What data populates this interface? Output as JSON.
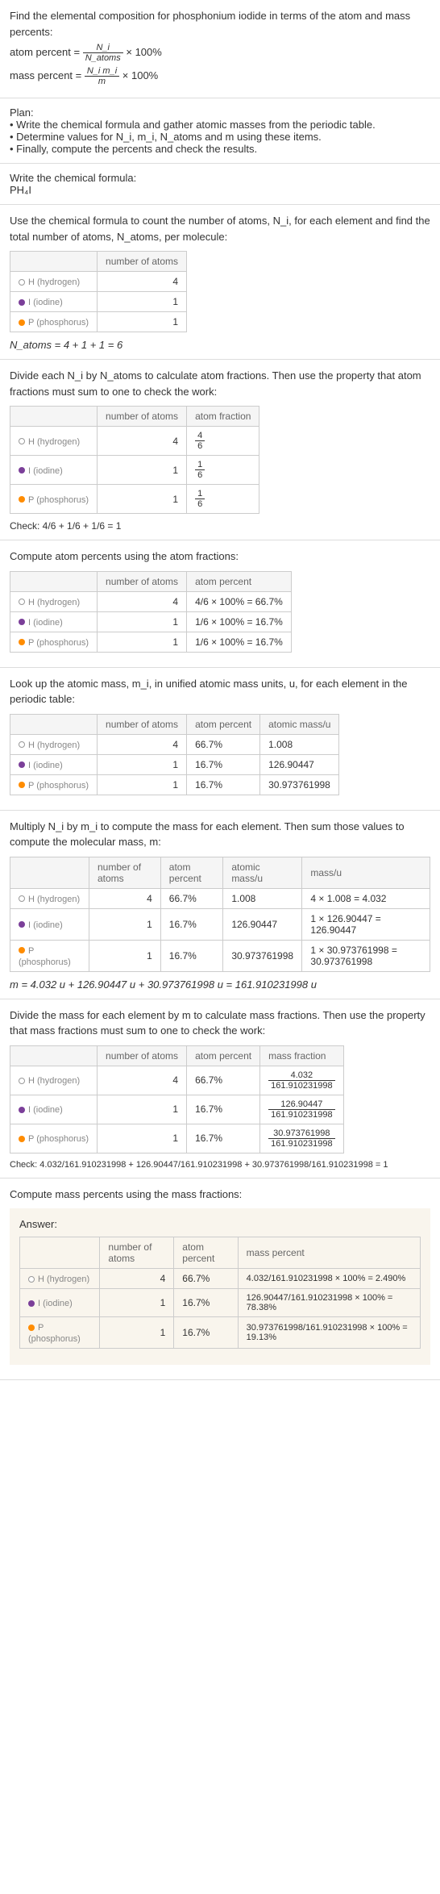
{
  "intro": {
    "title": "Find the elemental composition for phosphonium iodide in terms of the atom and mass percents:",
    "atom_percent_label": "atom percent = ",
    "atom_percent_frac_num": "N_i",
    "atom_percent_frac_den": "N_atoms",
    "times_100": " × 100%",
    "mass_percent_label": "mass percent = ",
    "mass_percent_frac_num": "N_i m_i",
    "mass_percent_frac_den": "m"
  },
  "plan": {
    "heading": "Plan:",
    "step1": "• Write the chemical formula and gather atomic masses from the periodic table.",
    "step2": "• Determine values for N_i, m_i, N_atoms and m using these items.",
    "step3": "• Finally, compute the percents and check the results."
  },
  "formula_section": {
    "heading": "Write the chemical formula:",
    "formula": "PH₄I"
  },
  "count_section": {
    "text": "Use the chemical formula to count the number of atoms, N_i, for each element and find the total number of atoms, N_atoms, per molecule:",
    "header_atoms": "number of atoms",
    "h_label": "H (hydrogen)",
    "i_label": "I (iodine)",
    "p_label": "P (phosphorus)",
    "h_atoms": "4",
    "i_atoms": "1",
    "p_atoms": "1",
    "total": "N_atoms = 4 + 1 + 1 = 6"
  },
  "atom_frac_section": {
    "text": "Divide each N_i by N_atoms to calculate atom fractions. Then use the property that atom fractions must sum to one to check the work:",
    "header_frac": "atom fraction",
    "h_frac_num": "4",
    "h_frac_den": "6",
    "i_frac_num": "1",
    "i_frac_den": "6",
    "p_frac_num": "1",
    "p_frac_den": "6",
    "check": "Check: 4/6 + 1/6 + 1/6 = 1"
  },
  "atom_pct_section": {
    "text": "Compute atom percents using the atom fractions:",
    "header_pct": "atom percent",
    "h_pct": "4/6 × 100% = 66.7%",
    "i_pct": "1/6 × 100% = 16.7%",
    "p_pct": "1/6 × 100% = 16.7%"
  },
  "mass_lookup_section": {
    "text": "Look up the atomic mass, m_i, in unified atomic mass units, u, for each element in the periodic table:",
    "header_mass": "atomic mass/u",
    "h_pct": "66.7%",
    "i_pct": "16.7%",
    "p_pct": "16.7%",
    "h_mass": "1.008",
    "i_mass": "126.90447",
    "p_mass": "30.973761998"
  },
  "mol_mass_section": {
    "text": "Multiply N_i by m_i to compute the mass for each element. Then sum those values to compute the molecular mass, m:",
    "header_massu": "mass/u",
    "h_calc": "4 × 1.008 = 4.032",
    "i_calc": "1 × 126.90447 = 126.90447",
    "p_calc": "1 × 30.973761998 = 30.973761998",
    "total": "m = 4.032 u + 126.90447 u + 30.973761998 u = 161.910231998 u"
  },
  "mass_frac_section": {
    "text": "Divide the mass for each element by m to calculate mass fractions. Then use the property that mass fractions must sum to one to check the work:",
    "header_massfrac": "mass fraction",
    "h_num": "4.032",
    "h_den": "161.910231998",
    "i_num": "126.90447",
    "i_den": "161.910231998",
    "p_num": "30.973761998",
    "p_den": "161.910231998",
    "check": "Check: 4.032/161.910231998 + 126.90447/161.910231998 + 30.973761998/161.910231998 = 1"
  },
  "mass_pct_section": {
    "text": "Compute mass percents using the mass fractions:"
  },
  "answer": {
    "heading": "Answer:",
    "header_masspct": "mass percent",
    "h_pct": "66.7%",
    "i_pct": "16.7%",
    "p_pct": "16.7%",
    "h_calc": "4.032/161.910231998 × 100% = 2.490%",
    "i_calc": "126.90447/161.910231998 × 100% = 78.38%",
    "p_calc": "30.973761998/161.910231998 × 100% = 19.13%"
  },
  "chart_data": {
    "type": "table",
    "title": "Elemental composition of phosphonium iodide (PH4I)",
    "formula": "PH4I",
    "N_atoms": 6,
    "molecular_mass_u": 161.910231998,
    "elements": [
      {
        "symbol": "H",
        "name": "hydrogen",
        "number_of_atoms": 4,
        "atom_fraction": "4/6",
        "atom_percent": 66.7,
        "atomic_mass_u": 1.008,
        "mass_u": 4.032,
        "mass_fraction_num": 4.032,
        "mass_fraction_den": 161.910231998,
        "mass_percent": 2.49
      },
      {
        "symbol": "I",
        "name": "iodine",
        "number_of_atoms": 1,
        "atom_fraction": "1/6",
        "atom_percent": 16.7,
        "atomic_mass_u": 126.90447,
        "mass_u": 126.90447,
        "mass_fraction_num": 126.90447,
        "mass_fraction_den": 161.910231998,
        "mass_percent": 78.38
      },
      {
        "symbol": "P",
        "name": "phosphorus",
        "number_of_atoms": 1,
        "atom_fraction": "1/6",
        "atom_percent": 16.7,
        "atomic_mass_u": 30.973761998,
        "mass_u": 30.973761998,
        "mass_fraction_num": 30.973761998,
        "mass_fraction_den": 161.910231998,
        "mass_percent": 19.13
      }
    ]
  }
}
